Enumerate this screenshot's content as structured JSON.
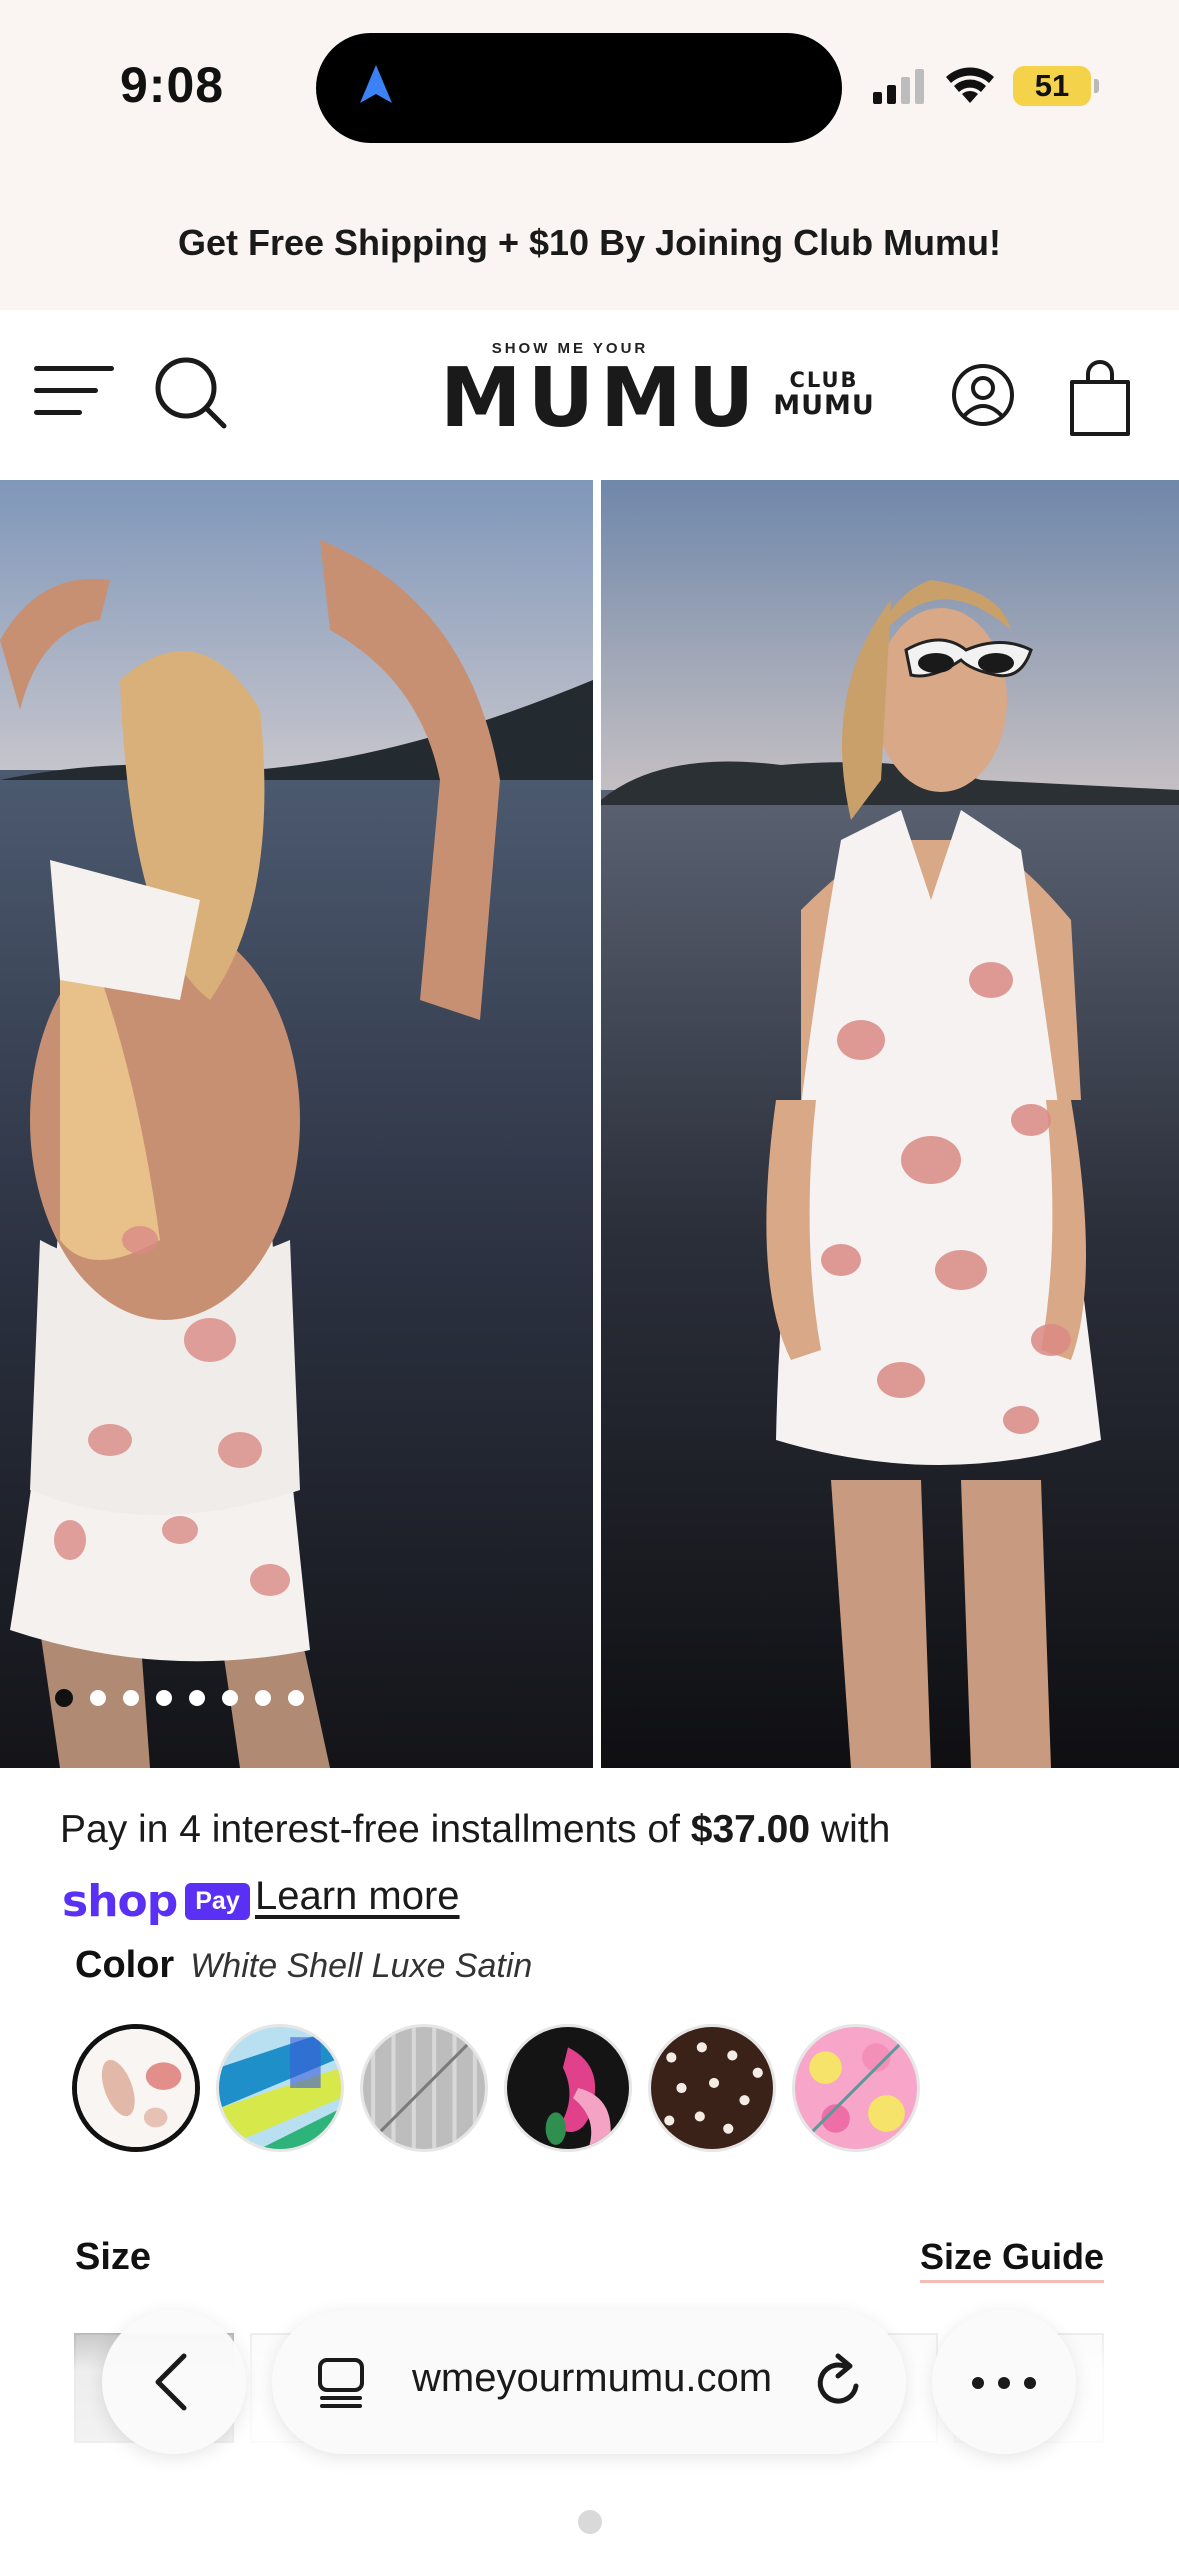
{
  "status_bar": {
    "time": "9:08",
    "battery_level": "51",
    "icons": [
      "location-arrow-icon",
      "cellular-signal-icon",
      "wifi-icon",
      "battery-icon"
    ]
  },
  "promo_banner": {
    "text": "Get Free Shipping + $10 By Joining Club Mumu!"
  },
  "header": {
    "logo_small": "SHOW ME YOUR",
    "logo_big": "MUMU",
    "club_line1": "CLUB",
    "club_line2": "MUMU",
    "icons": [
      "menu-icon",
      "search-icon",
      "account-icon",
      "shopping-bag-icon"
    ]
  },
  "gallery": {
    "total_images": 8,
    "active_index": 0
  },
  "product": {
    "installments_prefix": "Pay in 4 interest-free installments of ",
    "installments_amount": "$37.00",
    "installments_suffix": " with",
    "shop_pay_shop": "shop",
    "shop_pay_pay": "Pay",
    "learn_more": "Learn more",
    "color_label": "Color",
    "color_value": "White Shell Luxe Satin",
    "swatches": [
      {
        "name": "White Shell Luxe Satin",
        "selected": true
      },
      {
        "name": "Tropical Stripe",
        "selected": false
      },
      {
        "name": "Silver",
        "selected": false
      },
      {
        "name": "Black Floral",
        "selected": false
      },
      {
        "name": "Brown Polka Dot",
        "selected": false
      },
      {
        "name": "Pink Floral",
        "selected": false
      }
    ],
    "size_label": "Size",
    "size_guide": "Size Guide"
  },
  "browser": {
    "url": "wmeyourmumu.com",
    "icons": [
      "back-chevron-icon",
      "tabs-icon",
      "reload-icon",
      "more-icon"
    ]
  },
  "colors": {
    "shop_pay_purple": "#5a31f4",
    "battery_yellow": "#f4d24a",
    "banner_bg": "#faf5f2"
  }
}
